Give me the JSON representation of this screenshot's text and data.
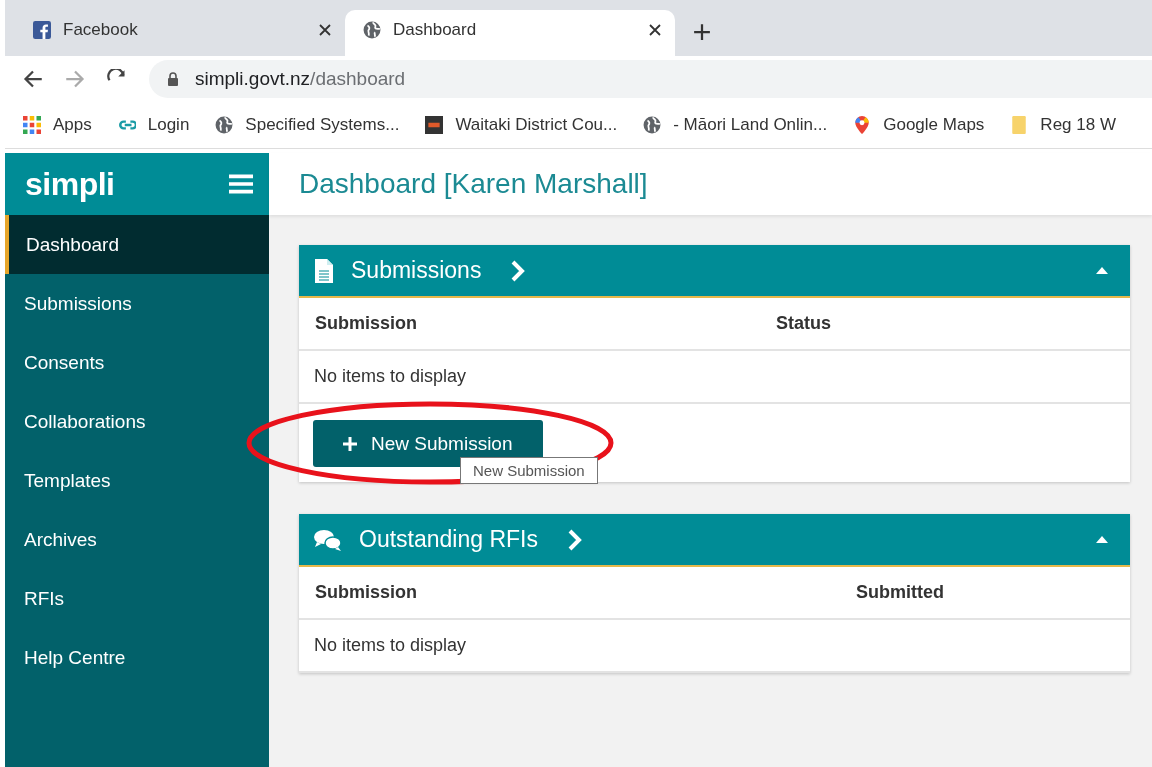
{
  "browser": {
    "tabs": [
      {
        "title": "Facebook",
        "kind": "facebook",
        "selected": false
      },
      {
        "title": "Dashboard",
        "kind": "globe",
        "selected": true
      }
    ],
    "address": {
      "host": "simpli.govt.nz",
      "path": "/dashboard"
    },
    "bookmarks": [
      {
        "label": "Apps",
        "kind": "apps"
      },
      {
        "label": "Login",
        "kind": "link"
      },
      {
        "label": "Specified Systems...",
        "kind": "globe"
      },
      {
        "label": "Waitaki District Cou...",
        "kind": "badge"
      },
      {
        "label": "- Māori Land Onlin...",
        "kind": "globe"
      },
      {
        "label": "Google Maps",
        "kind": "pin"
      },
      {
        "label": "Reg 18 W",
        "kind": "folder"
      }
    ]
  },
  "app": {
    "logo": "simpli",
    "page_title": "Dashboard [Karen Marshall]",
    "sidebar": {
      "items": [
        {
          "label": "Dashboard",
          "selected": true
        },
        {
          "label": "Submissions",
          "selected": false
        },
        {
          "label": "Consents",
          "selected": false
        },
        {
          "label": "Collaborations",
          "selected": false
        },
        {
          "label": "Templates",
          "selected": false
        },
        {
          "label": "Archives",
          "selected": false
        },
        {
          "label": "RFIs",
          "selected": false
        },
        {
          "label": "Help Centre",
          "selected": false
        }
      ]
    },
    "panels": [
      {
        "title": "Submissions",
        "kind": "document",
        "columns": [
          "Submission",
          "Status"
        ],
        "empty_text": "No items to display",
        "button": {
          "label": "New Submission",
          "tooltip": "New Submission",
          "highlighted": true
        }
      },
      {
        "title": "Outstanding RFIs",
        "kind": "chat",
        "columns": [
          "Submission",
          "Submitted"
        ],
        "empty_text": "No items to display"
      }
    ]
  }
}
